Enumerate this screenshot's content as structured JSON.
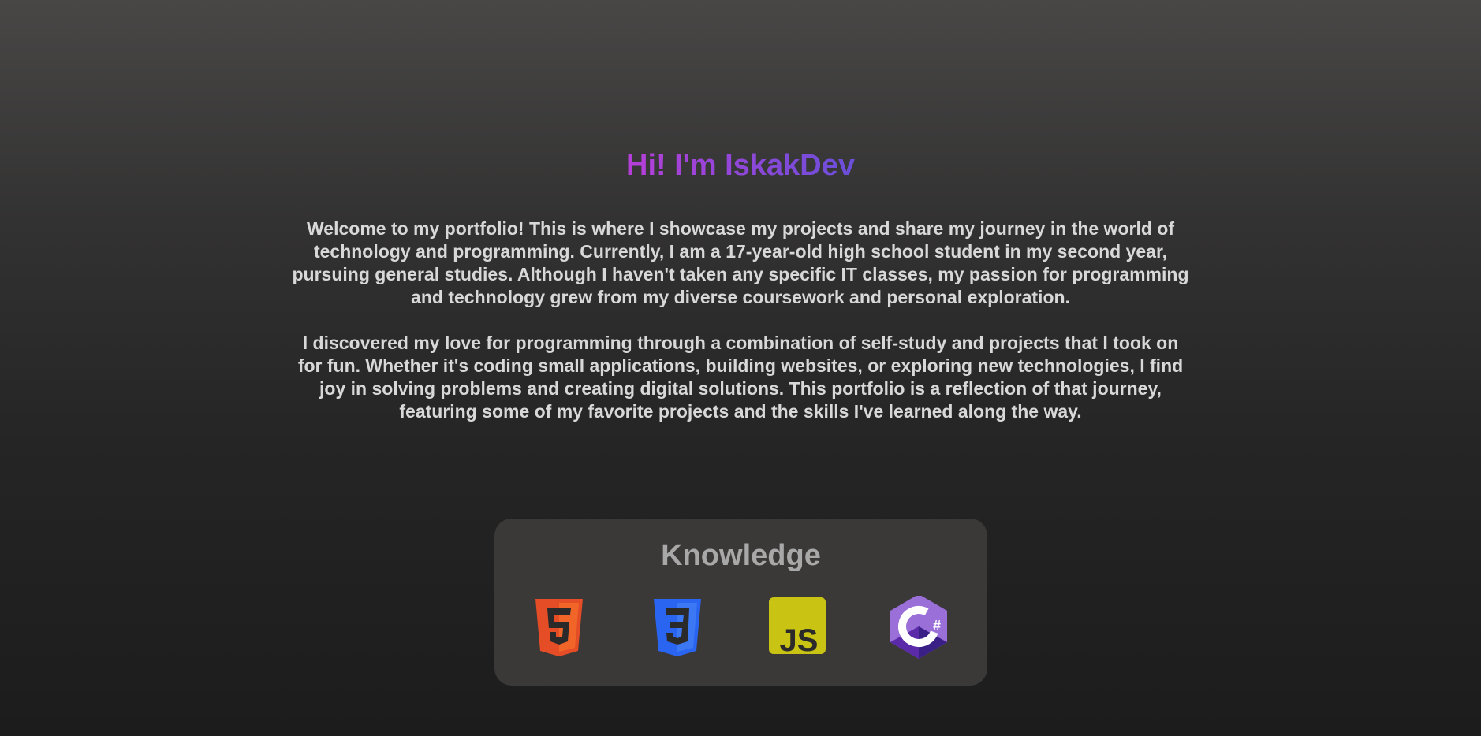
{
  "hero": {
    "title": "Hi! I'm IskakDev",
    "bio": [
      "Welcome to my portfolio! This is where I showcase my projects and share my journey in the world of technology and programming. Currently, I am a 17-year-old high school student in my second year, pursuing general studies. Although I haven't taken any specific IT classes, my passion for programming and technology grew from my diverse coursework and personal exploration.",
      "I discovered my love for programming through a combination of self-study and projects that I took on for fun. Whether it's coding small applications, building websites, or exploring new technologies, I find joy in solving problems and creating digital solutions. This portfolio is a reflection of that journey, featuring some of my favorite projects and the skills I've learned along the way."
    ],
    "title_gradient": [
      "#b63fd8",
      "#6a4fd9"
    ]
  },
  "knowledge": {
    "heading": "Knowledge",
    "items": [
      {
        "icon": "html5-icon",
        "color": "#e44d26"
      },
      {
        "icon": "css3-icon",
        "color": "#2965f1"
      },
      {
        "icon": "javascript-icon",
        "color": "#c9c314",
        "label": "JS"
      },
      {
        "icon": "csharp-icon",
        "color": "#9b4f96",
        "label": "#"
      }
    ]
  }
}
